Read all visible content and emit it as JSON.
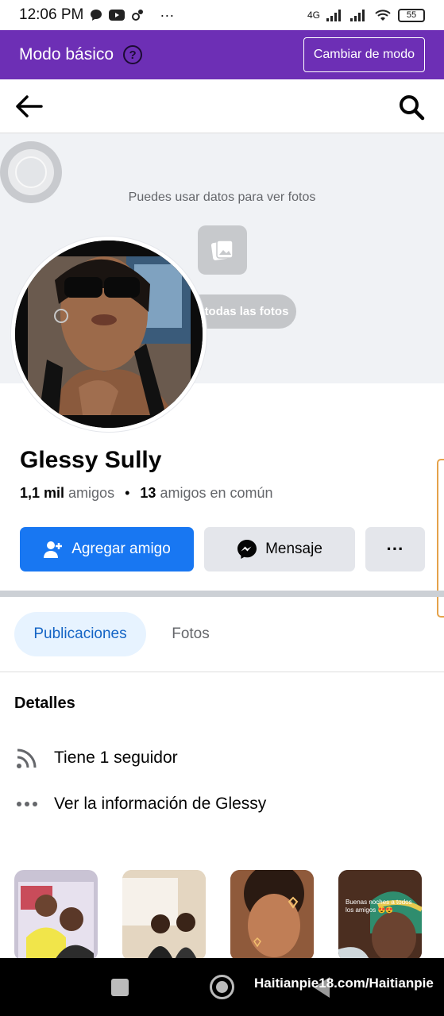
{
  "status_bar": {
    "time": "12:06 PM",
    "dots": "···",
    "network": "4G",
    "battery": "55"
  },
  "basic_mode_bar": {
    "title": "Modo básico",
    "help": "?",
    "switch_button": "Cambiar de modo",
    "background_color": "#6d2fb5"
  },
  "cover": {
    "message": "Puedes usar datos para ver fotos",
    "see_all_photos": "todas las fotos"
  },
  "profile": {
    "name": "Glessy Sully",
    "friend_count": "1,1 mil",
    "friends_label": "amigos",
    "bullet": "•",
    "mutual_count": "13",
    "mutual_label": "amigos en común"
  },
  "actions": {
    "add_friend": "Agregar amigo",
    "message": "Mensaje",
    "more": "···",
    "primary_color": "#1877f2"
  },
  "tabs": [
    {
      "label": "Publicaciones",
      "active": true
    },
    {
      "label": "Fotos",
      "active": false
    }
  ],
  "details": {
    "title": "Detalles",
    "items": [
      {
        "icon": "rss-icon",
        "text": "Tiene 1 seguidor"
      },
      {
        "icon": "more-dots-icon",
        "text": "Ver la información de Glessy"
      }
    ]
  },
  "thumbnails": [
    {
      "caption": ""
    },
    {
      "caption": ""
    },
    {
      "caption": ""
    },
    {
      "caption": "Buenas noches a todos los amigos 😍😍"
    }
  ],
  "system_nav": {
    "watermark": "Haitianpie18.com/Haitianpie"
  }
}
